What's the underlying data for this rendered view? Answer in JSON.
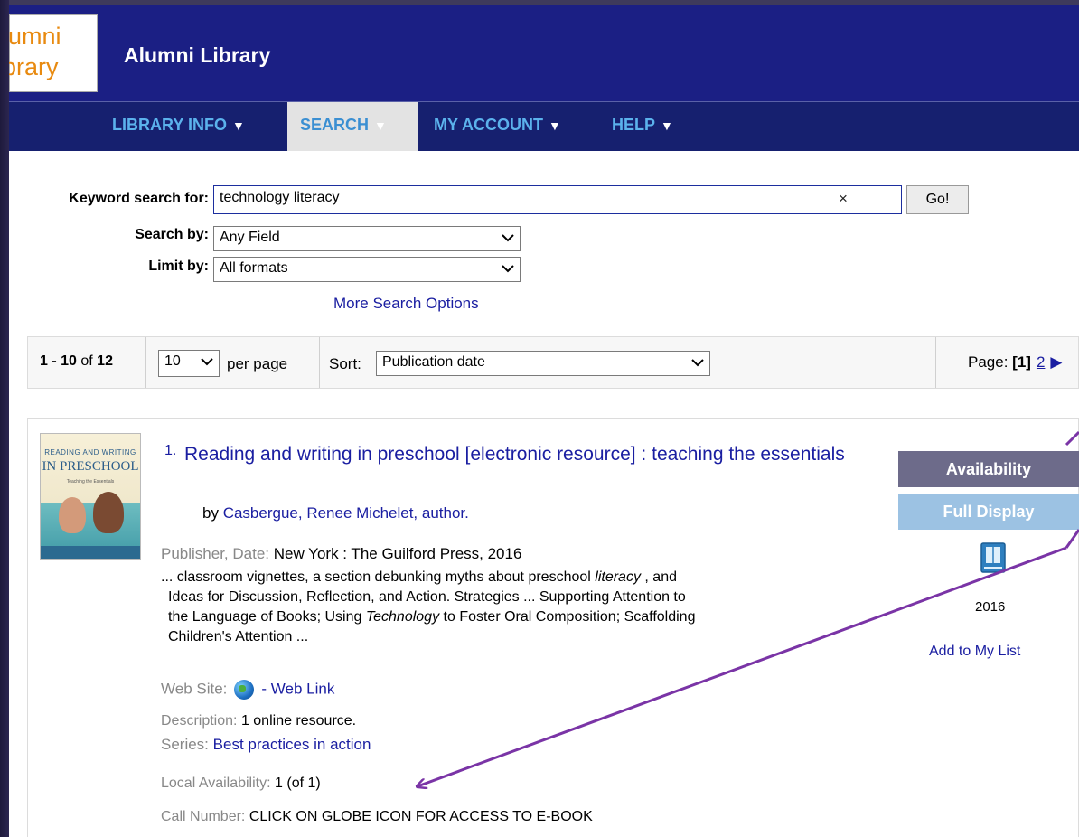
{
  "header": {
    "logo_text_line1": "lumni",
    "logo_text_line2": "brary",
    "site_title": "Alumni Library"
  },
  "nav": {
    "items": [
      {
        "label": "LIBRARY INFO"
      },
      {
        "label": "SEARCH"
      },
      {
        "label": "MY ACCOUNT"
      },
      {
        "label": "HELP"
      }
    ],
    "arrow_glyph": "▼"
  },
  "search": {
    "keyword_label": "Keyword search for:",
    "keyword_value": "technology literacy",
    "clear_glyph": "×",
    "go_label": "Go!",
    "search_by_label": "Search by:",
    "search_by_value": "Any Field",
    "limit_by_label": "Limit by:",
    "limit_by_value": "All formats",
    "more_options": "More Search Options"
  },
  "results_bar": {
    "range": "1 - 10",
    "of": "of",
    "total": "12",
    "per_page_value": "10",
    "per_page_label": "per page",
    "sort_label": "Sort:",
    "sort_value": "Publication date",
    "page_label": "Page:",
    "current_page": "[1]",
    "next_page": "2",
    "next_glyph": "▶"
  },
  "result": {
    "number": "1.",
    "title": "Reading and writing in preschool [electronic resource] : teaching the essentials",
    "by": "by",
    "author": "Casbergue, Renee Michelet, author.",
    "publisher_label": "Publisher, Date:",
    "publisher_value": "New York : The Guilford Press, 2016",
    "snippet": {
      "p1": "... classroom vignettes, a section debunking myths about preschool ",
      "em1": "literacy",
      "p2": " , and",
      "line2": "Ideas for Discussion, Reflection, and Action. Strategies ... Supporting Attention to",
      "p3": "the Language of Books; Using ",
      "em2": "Technology",
      "p4": " to Foster Oral Composition; Scaffolding",
      "line4": "Children's Attention ..."
    },
    "website_label": "Web Site:",
    "website_link": "- Web Link",
    "description_label": "Description:",
    "description_value": "1 online resource.",
    "series_label": "Series:",
    "series_value": "Best practices in action",
    "local_label": "Local Availability:",
    "local_value": "1 (of 1)",
    "callno_label": "Call Number:",
    "callno_value": "CLICK ON GLOBE ICON FOR ACCESS TO E-BOOK",
    "cover": {
      "line1": "READING AND WRITING",
      "line2": "IN PRESCHOOL",
      "line3": "Teaching the Essentials"
    }
  },
  "side": {
    "availability_button": "Availability",
    "full_display_button": "Full Display",
    "year": "2016",
    "add_to_list": "Add to My List"
  },
  "colors": {
    "header_bg": "#1b1f84",
    "nav_bg": "#16206f",
    "nav_text": "#5bb2ec",
    "link": "#1a1ea1",
    "annotation_arrow": "#7a34a6"
  }
}
